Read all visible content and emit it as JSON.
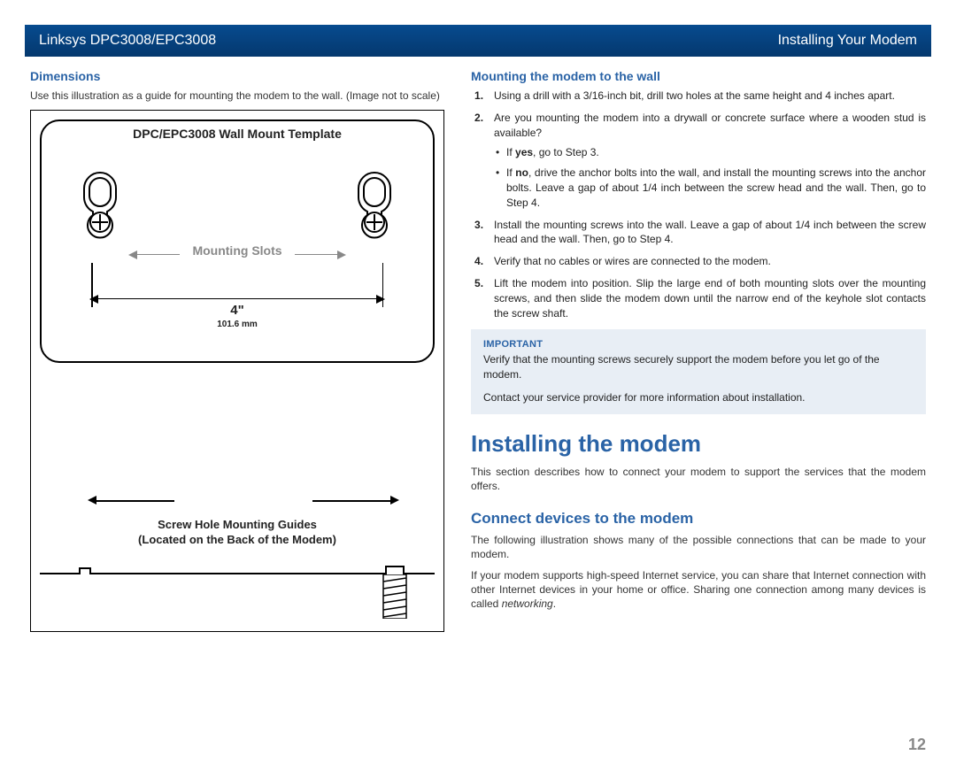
{
  "header": {
    "left": "Linksys DPC3008/EPC3008",
    "right": "Installing Your Modem"
  },
  "left": {
    "heading": "Dimensions",
    "caption": "Use this illustration as a guide for mounting the modem to the wall. (Image not to scale)",
    "template_title": "DPC/EPC3008 Wall Mount Template",
    "mount_slots": "Mounting Slots",
    "dim_in": "4\"",
    "dim_mm": "101.6 mm",
    "guide_line1": "Screw Hole Mounting Guides",
    "guide_line2": "(Located on the Back of the Modem)"
  },
  "right": {
    "heading": "Mounting the modem to the wall",
    "steps": {
      "s1": "Using a drill with a 3/16-inch bit, drill two holes at the same height and 4 inches apart.",
      "s2": "Are you mounting the modem into a drywall or concrete surface where a wooden stud is available?",
      "s2a_pre": "If ",
      "s2a_bold": "yes",
      "s2a_post": ", go to Step 3.",
      "s2b_pre": "If ",
      "s2b_bold": "no",
      "s2b_post": ", drive the anchor bolts into the wall, and install the mounting screws into the anchor bolts. Leave a gap of about 1/4 inch between the screw head and the wall. Then, go to Step 4.",
      "s3": "Install the mounting screws into the wall. Leave a gap of about 1/4 inch between the screw head and the wall. Then, go to Step 4.",
      "s4": "Verify that no cables or wires are connected to the modem.",
      "s5": "Lift the modem into position. Slip the large end of both mounting slots over the mounting screws, and then slide the modem down until the narrow end of the keyhole slot contacts the screw shaft."
    },
    "callout": {
      "label": "IMPORTANT",
      "p1": "Verify that the mounting screws securely support the modem before you let go of the modem.",
      "p2": "Contact your service provider for more information about installation."
    },
    "section_title": "Installing the modem",
    "section_intro": "This section describes how to connect your modem to support the services that the modem offers.",
    "connect_heading": "Connect devices to the modem",
    "connect_p1": "The following illustration shows many of the possible connections that can be made to your modem.",
    "connect_p2a": "If your modem supports high-speed Internet service, you can share that Internet connection with other Internet devices in your home or office. Sharing one connection among many devices is called ",
    "connect_p2_em": "networking",
    "connect_p2b": "."
  },
  "page_number": "12"
}
